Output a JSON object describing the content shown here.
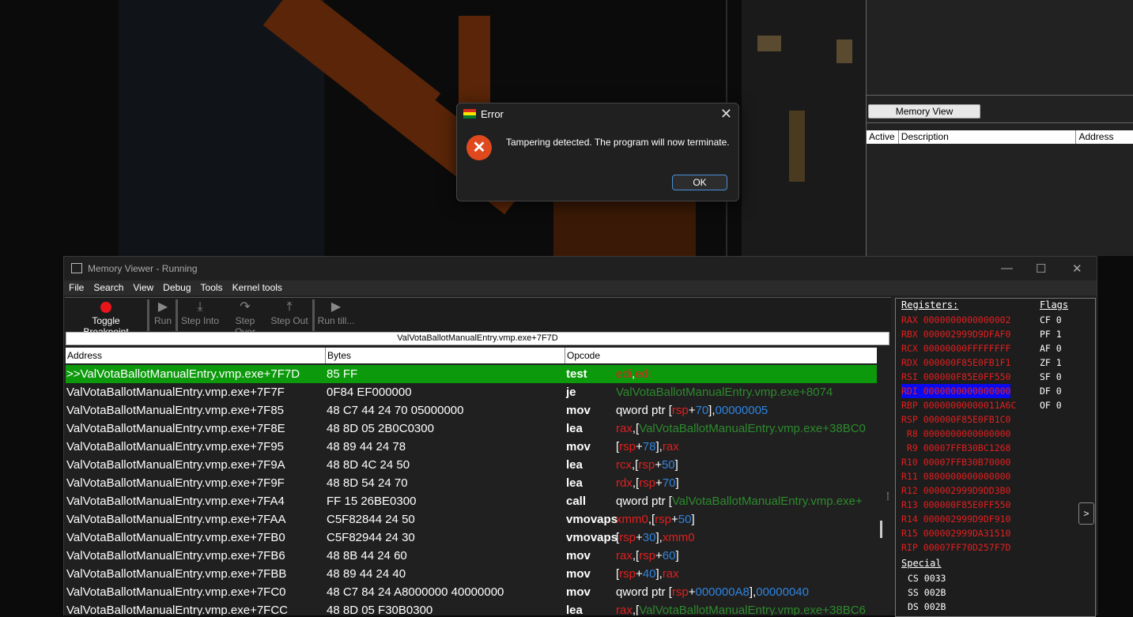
{
  "dialog": {
    "title": "Error",
    "message": "Tampering detected. The program will now terminate.",
    "ok_label": "OK",
    "close_glyph": "✕",
    "icon_glyph": "✕"
  },
  "main_window": {
    "memory_view_button": "Memory View",
    "columns": [
      "Active",
      "Description",
      "Address"
    ]
  },
  "memory_viewer": {
    "title": "Memory Viewer - Running",
    "window_buttons": [
      "—",
      "☐",
      "✕"
    ],
    "menu": [
      "File",
      "Search",
      "View",
      "Debug",
      "Tools",
      "Kernel tools"
    ],
    "toolbar": [
      {
        "label": "Toggle Breakpoint",
        "icon": "breakpoint-icon",
        "active": true
      },
      {
        "label": "Run",
        "icon": "run-icon",
        "glyph": "▶",
        "active": false
      },
      {
        "label": "Step Into",
        "icon": "step-into-icon",
        "glyph": "⤓",
        "active": false
      },
      {
        "label": "Step Over",
        "icon": "step-over-icon",
        "glyph": "↷",
        "active": false
      },
      {
        "label": "Step Out",
        "icon": "step-out-icon",
        "glyph": "⤒",
        "active": false
      },
      {
        "label": "Run till...",
        "icon": "run-till-icon",
        "glyph": "▶",
        "active": false
      }
    ],
    "address_bar": "ValVotaBallotManualEntry.vmp.exe+7F7D",
    "headers": {
      "address": "Address",
      "bytes": "Bytes",
      "opcode": "Opcode"
    },
    "rows": [
      {
        "address": ">>ValVotaBallotManualEntry.vmp.exe+7F7D",
        "bytes": "85 FF",
        "opcode": "test",
        "args": [
          [
            "edi",
            "rg"
          ],
          [
            ",",
            ""
          ],
          [
            "edi",
            "rg"
          ]
        ],
        "selected": true
      },
      {
        "address": "ValVotaBallotManualEntry.vmp.exe+7F7F",
        "bytes": "0F84 EF000000",
        "opcode": "je",
        "args": [
          [
            "ValVotaBallotManualEntry.vmp.exe+8074",
            "sy"
          ]
        ]
      },
      {
        "address": "ValVotaBallotManualEntry.vmp.exe+7F85",
        "bytes": "48 C7 44 24 70 05000000",
        "opcode": "mov",
        "args": [
          [
            "qword ptr [",
            ""
          ],
          [
            "rsp",
            "rg"
          ],
          [
            "+",
            ""
          ],
          [
            "70",
            "nm"
          ],
          [
            "],",
            ""
          ],
          [
            "00000005",
            "nm"
          ]
        ]
      },
      {
        "address": "ValVotaBallotManualEntry.vmp.exe+7F8E",
        "bytes": "48 8D 05 2B0C0300",
        "opcode": "lea",
        "args": [
          [
            "rax",
            "rg"
          ],
          [
            ",[",
            ""
          ],
          [
            "ValVotaBallotManualEntry.vmp.exe+38BC0",
            "sy"
          ]
        ]
      },
      {
        "address": "ValVotaBallotManualEntry.vmp.exe+7F95",
        "bytes": "48 89 44 24 78",
        "opcode": "mov",
        "args": [
          [
            "[",
            ""
          ],
          [
            "rsp",
            "rg"
          ],
          [
            "+",
            ""
          ],
          [
            "78",
            "nm"
          ],
          [
            "],",
            ""
          ],
          [
            "rax",
            "rg"
          ]
        ]
      },
      {
        "address": "ValVotaBallotManualEntry.vmp.exe+7F9A",
        "bytes": "48 8D 4C 24 50",
        "opcode": "lea",
        "args": [
          [
            "rcx",
            "rg"
          ],
          [
            ",[",
            ""
          ],
          [
            "rsp",
            "rg"
          ],
          [
            "+",
            ""
          ],
          [
            "50",
            "nm"
          ],
          [
            "]",
            ""
          ]
        ]
      },
      {
        "address": "ValVotaBallotManualEntry.vmp.exe+7F9F",
        "bytes": "48 8D 54 24 70",
        "opcode": "lea",
        "args": [
          [
            "rdx",
            "rg"
          ],
          [
            ",[",
            ""
          ],
          [
            "rsp",
            "rg"
          ],
          [
            "+",
            ""
          ],
          [
            "70",
            "nm"
          ],
          [
            "]",
            ""
          ]
        ]
      },
      {
        "address": "ValVotaBallotManualEntry.vmp.exe+7FA4",
        "bytes": "FF 15 26BE0300",
        "opcode": "call",
        "args": [
          [
            "qword ptr [",
            ""
          ],
          [
            "ValVotaBallotManualEntry.vmp.exe+",
            "sy"
          ]
        ]
      },
      {
        "address": "ValVotaBallotManualEntry.vmp.exe+7FAA",
        "bytes": "C5F82844 24 50",
        "opcode": "vmovaps",
        "args": [
          [
            "xmm0",
            "rg"
          ],
          [
            ",[",
            ""
          ],
          [
            "rsp",
            "rg"
          ],
          [
            "+",
            ""
          ],
          [
            "50",
            "nm"
          ],
          [
            "]",
            ""
          ]
        ]
      },
      {
        "address": "ValVotaBallotManualEntry.vmp.exe+7FB0",
        "bytes": "C5F82944 24 30",
        "opcode": "vmovaps",
        "args": [
          [
            "[",
            ""
          ],
          [
            "rsp",
            "rg"
          ],
          [
            "+",
            ""
          ],
          [
            "30",
            "nm"
          ],
          [
            "],",
            ""
          ],
          [
            "xmm0",
            "rg"
          ]
        ]
      },
      {
        "address": "ValVotaBallotManualEntry.vmp.exe+7FB6",
        "bytes": "48 8B 44 24 60",
        "opcode": "mov",
        "args": [
          [
            "rax",
            "rg"
          ],
          [
            ",[",
            ""
          ],
          [
            "rsp",
            "rg"
          ],
          [
            "+",
            ""
          ],
          [
            "60",
            "nm"
          ],
          [
            "]",
            ""
          ]
        ]
      },
      {
        "address": "ValVotaBallotManualEntry.vmp.exe+7FBB",
        "bytes": "48 89 44 24 40",
        "opcode": "mov",
        "args": [
          [
            "[",
            ""
          ],
          [
            "rsp",
            "rg"
          ],
          [
            "+",
            ""
          ],
          [
            "40",
            "nm"
          ],
          [
            "],",
            ""
          ],
          [
            "rax",
            "rg"
          ]
        ]
      },
      {
        "address": "ValVotaBallotManualEntry.vmp.exe+7FC0",
        "bytes": "48 C7 84 24 A8000000 40000000",
        "opcode": "mov",
        "args": [
          [
            "qword ptr [",
            ""
          ],
          [
            "rsp",
            "rg"
          ],
          [
            "+",
            ""
          ],
          [
            "000000A8",
            "nm"
          ],
          [
            "],",
            ""
          ],
          [
            "00000040",
            "nm"
          ]
        ]
      },
      {
        "address": "ValVotaBallotManualEntry.vmp.exe+7FCC",
        "bytes": "48 8D 05 F30B0300",
        "opcode": "lea",
        "args": [
          [
            "rax",
            "rg"
          ],
          [
            ",[",
            ""
          ],
          [
            "ValVotaBallotManualEntry.vmp.exe+38BC6",
            "sy"
          ]
        ]
      }
    ],
    "registers_title": "Registers:",
    "flags_title": "Flags",
    "registers": [
      {
        "name": "RAX",
        "value": "0000000000000002"
      },
      {
        "name": "RBX",
        "value": "000002999D9DFAF0"
      },
      {
        "name": "RCX",
        "value": "00000000FFFFFFFF"
      },
      {
        "name": "RDX",
        "value": "000000F85E0FB1F1"
      },
      {
        "name": "RSI",
        "value": "000000F85E0FF550"
      },
      {
        "name": "RDI",
        "value": "0000000000000000",
        "highlight": true
      },
      {
        "name": "RBP",
        "value": "00000000000011A6C"
      },
      {
        "name": "RSP",
        "value": "000000F85E0FB1C0"
      },
      {
        "name": " R8",
        "value": "0000000000000000"
      },
      {
        "name": " R9",
        "value": "00007FFB30BC1268"
      },
      {
        "name": "R10",
        "value": "00007FFB30B70000"
      },
      {
        "name": "R11",
        "value": "0800000000000000"
      },
      {
        "name": "R12",
        "value": "000002999D9DD3B0"
      },
      {
        "name": "R13",
        "value": "000000F85E0FF550"
      },
      {
        "name": "R14",
        "value": "000002999D9DF910"
      },
      {
        "name": "R15",
        "value": "000002999DA31510"
      },
      {
        "name": "RIP",
        "value": "00007FF70D257F7D"
      }
    ],
    "flags": [
      {
        "name": "CF",
        "value": "0"
      },
      {
        "name": "PF",
        "value": "1"
      },
      {
        "name": "AF",
        "value": "0"
      },
      {
        "name": "ZF",
        "value": "1"
      },
      {
        "name": "SF",
        "value": "0"
      },
      {
        "name": "DF",
        "value": "0"
      },
      {
        "name": "OF",
        "value": "0"
      }
    ],
    "special_title": "Special",
    "segments": [
      {
        "name": "CS",
        "value": "0033"
      },
      {
        "name": "SS",
        "value": "002B"
      },
      {
        "name": "DS",
        "value": "002B"
      }
    ],
    "expand_glyph": ">",
    "splitter_glyph": "⁞"
  },
  "colors": {
    "selected_row": "#0c9a0c",
    "register_text": "#e21f1f",
    "number": "#2f84e0",
    "symbol": "#2d8a2d",
    "error_icon": "#e0491e",
    "breakpoint": "#e8161b"
  }
}
